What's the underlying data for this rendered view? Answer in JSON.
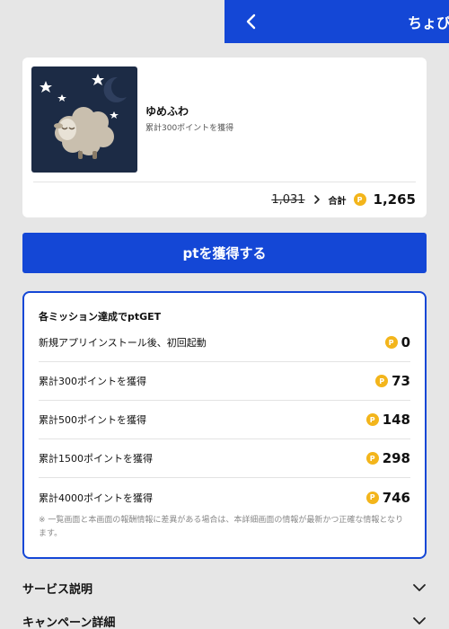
{
  "header": {
    "title": "ちょびリッチ"
  },
  "app": {
    "name": "ゆめふわ",
    "description": "累計300ポイントを獲得",
    "old_price": "1,031",
    "total_label": "合計",
    "total_value": "1,265",
    "coin_symbol": "P"
  },
  "cta": {
    "label": "ptを獲得する"
  },
  "missions": {
    "title": "各ミッション達成でptGET",
    "items": [
      {
        "label": "新規アプリインストール後、初回起動",
        "points": "0"
      },
      {
        "label": "累計300ポイントを獲得",
        "points": "73"
      },
      {
        "label": "累計500ポイントを獲得",
        "points": "148"
      },
      {
        "label": "累計1500ポイントを獲得",
        "points": "298"
      },
      {
        "label": "累計4000ポイントを獲得",
        "points": "746"
      }
    ],
    "note": "※ 一覧画面と本画面の報酬情報に差異がある場合は、本詳細画面の情報が最新かつ正確な情報となります。"
  },
  "sections": [
    {
      "label": "サービス説明"
    },
    {
      "label": "キャンペーン詳細"
    }
  ],
  "colors": {
    "primary": "#1447d6",
    "coin": "#f3b51b",
    "background": "#e6e6e6"
  }
}
